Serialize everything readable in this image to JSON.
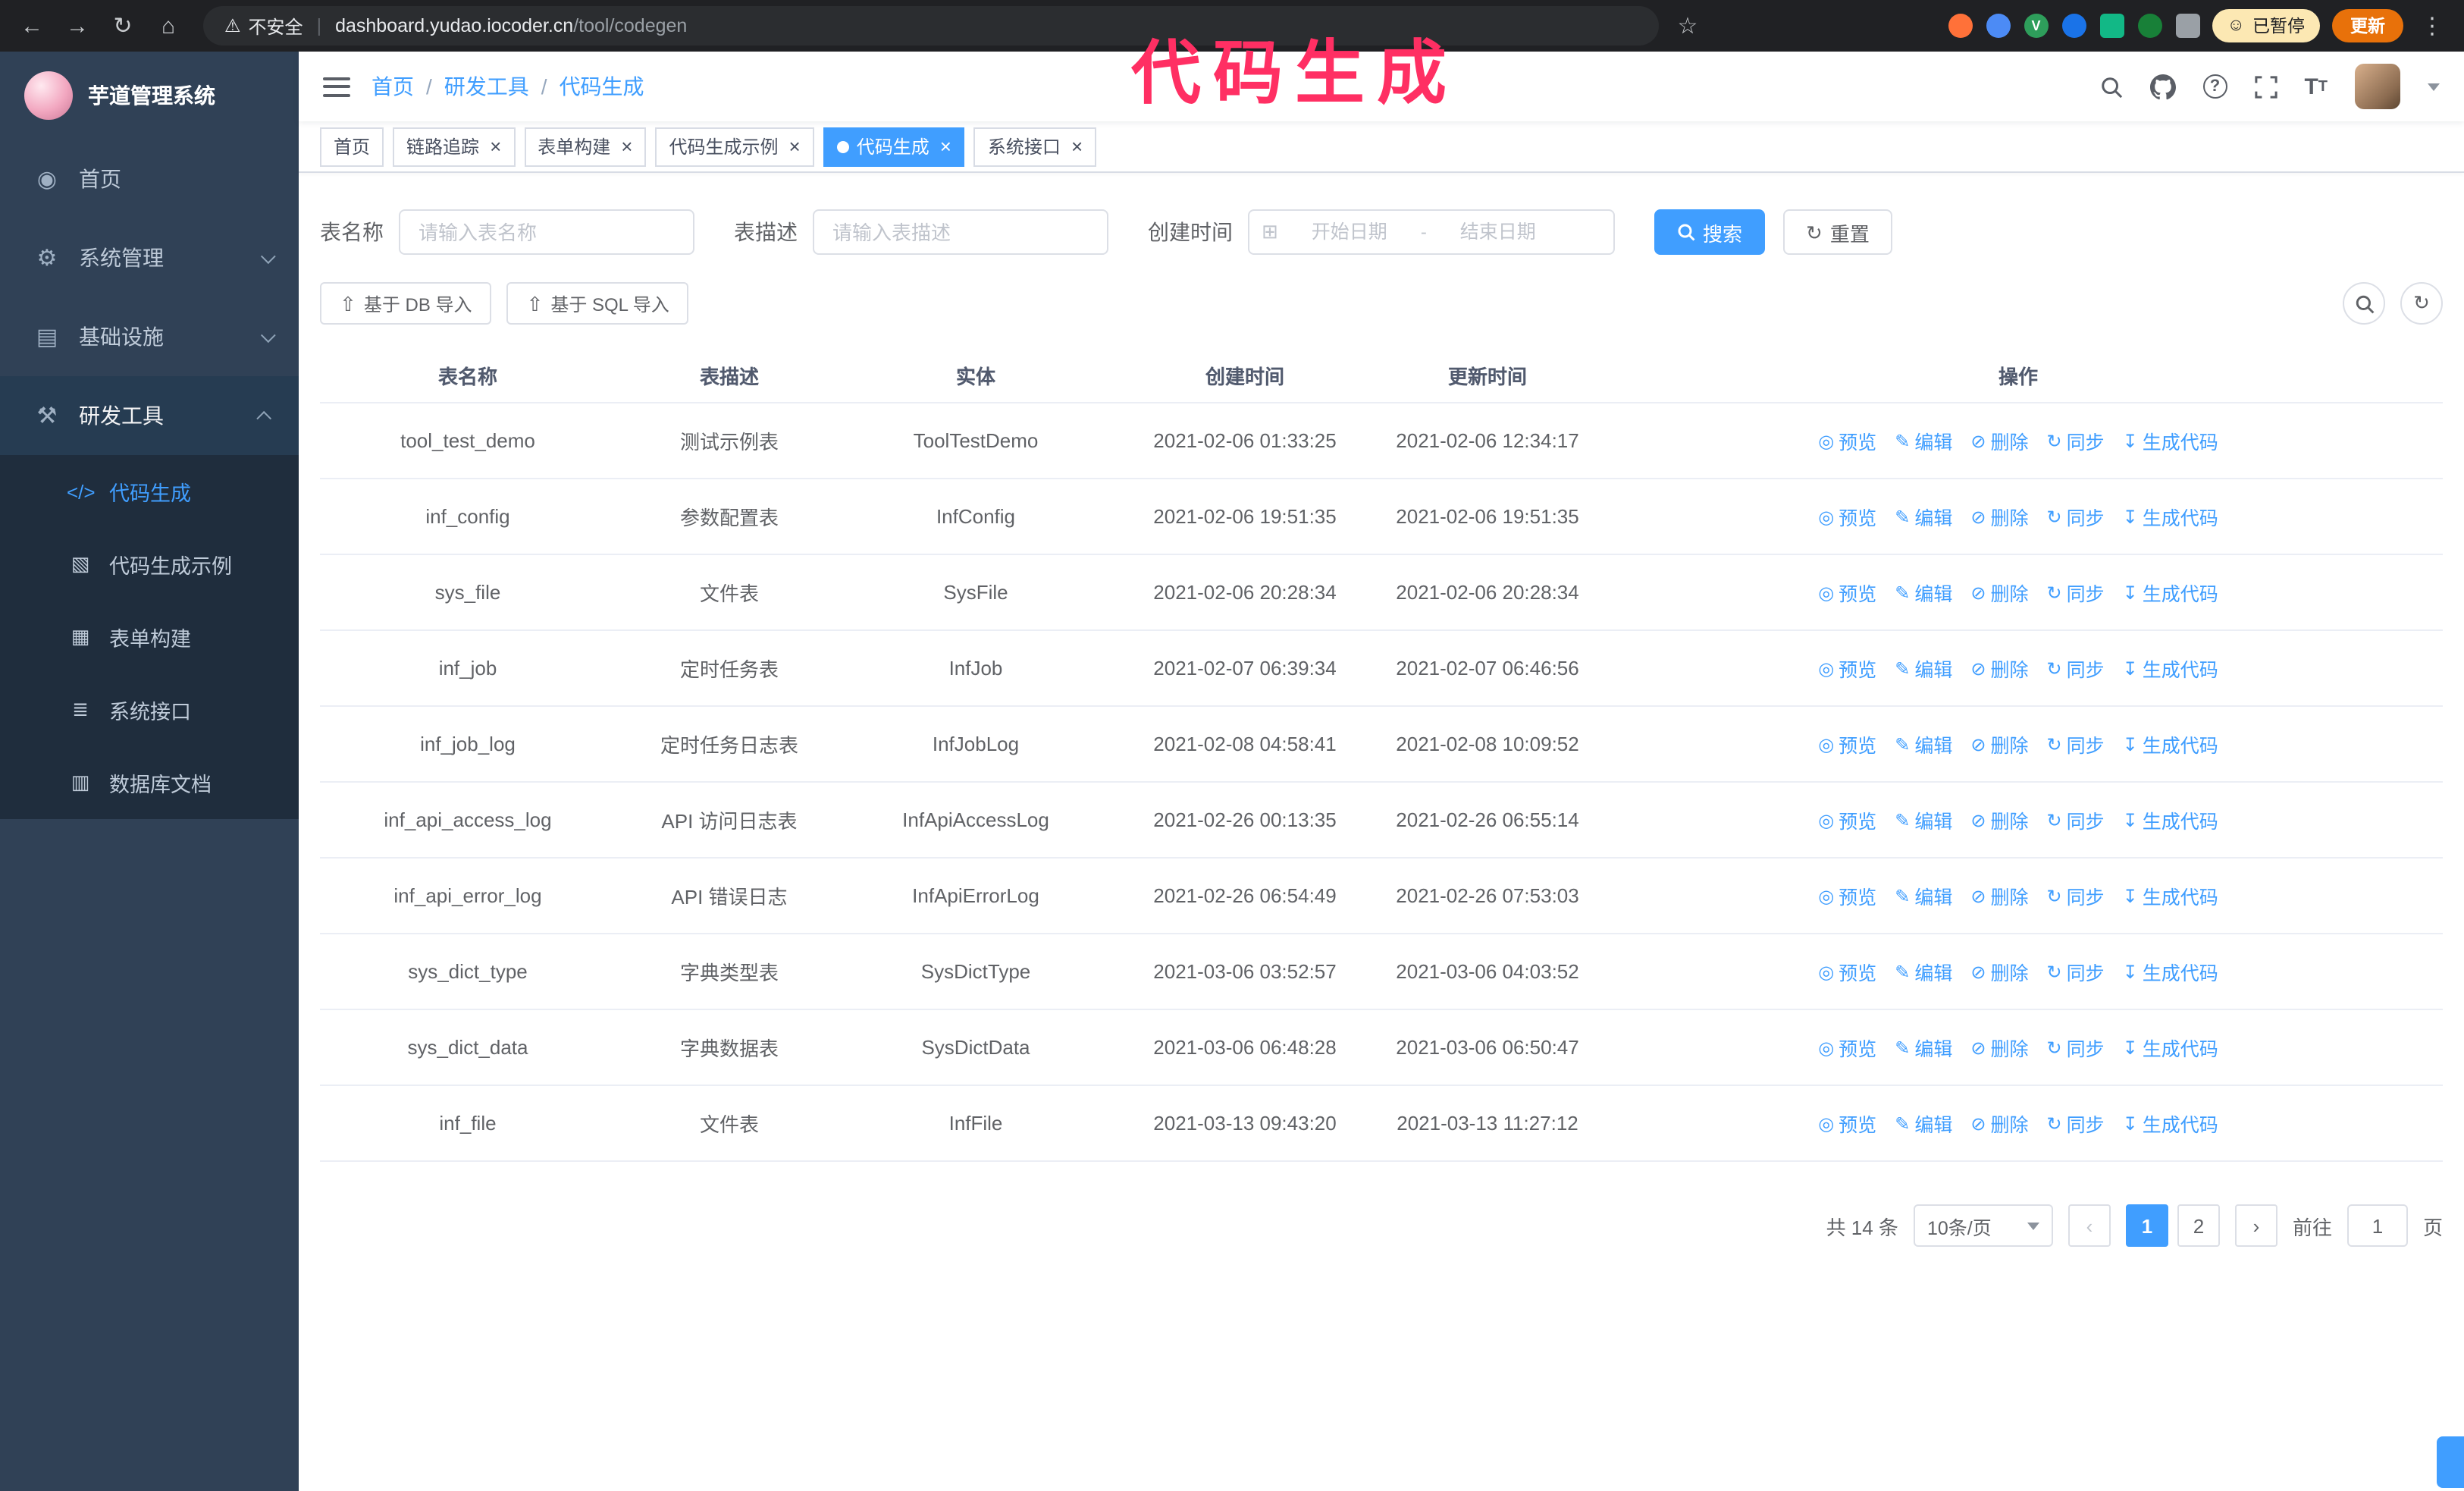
{
  "colors": {
    "accent": "#409eff",
    "annotation_pink": "#ff2f63",
    "sidebar_bg": "#304156",
    "submenu_bg": "#1f2d3d",
    "chrome_bg": "#202124",
    "update_button_orange": "#e8710a",
    "active_tab_bg": "#409eff"
  },
  "annotation": {
    "text": "代码生成"
  },
  "browser": {
    "security_label": "不安全",
    "url_host": "dashboard.yudao.iocoder.cn",
    "url_path": "/tool/codegen",
    "paused_label": "已暂停",
    "update_label": "更新",
    "extensions": [
      {
        "name": "orange-extension-icon",
        "color": "#ff7139"
      },
      {
        "name": "blue-drop-extension-icon",
        "color": "#4c8bf5"
      },
      {
        "name": "green-check-extension-icon",
        "color": "#2e9e5b",
        "glyph": "V"
      },
      {
        "name": "people-extension-icon",
        "color": "#1a73e8"
      },
      {
        "name": "green-square-extension-icon",
        "color": "#12b886",
        "square": true
      },
      {
        "name": "leaf-extension-icon",
        "color": "#188038"
      },
      {
        "name": "puzzle-extension-icon",
        "color": "#9aa0a6",
        "square": true
      }
    ]
  },
  "sidebar": {
    "logo_title": "芋道管理系统",
    "items": [
      {
        "key": "home",
        "label": "首页",
        "icon": "home"
      },
      {
        "key": "system",
        "label": "系统管理",
        "icon": "system",
        "chevron": "down"
      },
      {
        "key": "infra",
        "label": "基础设施",
        "icon": "infra",
        "chevron": "down"
      },
      {
        "key": "dev-tools",
        "label": "研发工具",
        "icon": "dev",
        "chevron": "up",
        "open": true
      }
    ],
    "subitems": [
      {
        "key": "codegen",
        "label": "代码生成",
        "icon": "codegen",
        "active": true
      },
      {
        "key": "codegen-example",
        "label": "代码生成示例",
        "icon": "example"
      },
      {
        "key": "form-builder",
        "label": "表单构建",
        "icon": "form"
      },
      {
        "key": "api",
        "label": "系统接口",
        "icon": "api"
      },
      {
        "key": "db-doc",
        "label": "数据库文档",
        "icon": "dbdoc"
      }
    ]
  },
  "header": {
    "breadcrumb": [
      "首页",
      "研发工具",
      "代码生成"
    ]
  },
  "tabs": [
    {
      "key": "home",
      "label": "首页",
      "closable": false,
      "active": false
    },
    {
      "key": "tracer",
      "label": "链路追踪",
      "closable": true,
      "active": false
    },
    {
      "key": "form-builder",
      "label": "表单构建",
      "closable": true,
      "active": false
    },
    {
      "key": "codegen-example",
      "label": "代码生成示例",
      "closable": true,
      "active": false
    },
    {
      "key": "codegen",
      "label": "代码生成",
      "closable": true,
      "active": true
    },
    {
      "key": "api",
      "label": "系统接口",
      "closable": true,
      "active": false
    }
  ],
  "filters": {
    "table_name_label": "表名称",
    "table_name_placeholder": "请输入表名称",
    "table_desc_label": "表描述",
    "table_desc_placeholder": "请输入表描述",
    "create_time_label": "创建时间",
    "date_start_placeholder": "开始日期",
    "date_separator": "-",
    "date_end_placeholder": "结束日期",
    "search_label": "搜索",
    "reset_label": "重置"
  },
  "toolbar": {
    "import_db_label": "基于 DB 导入",
    "import_sql_label": "基于 SQL 导入"
  },
  "table": {
    "columns": [
      "表名称",
      "表描述",
      "实体",
      "创建时间",
      "更新时间",
      "操作"
    ],
    "actions": [
      {
        "key": "preview",
        "label": "预览"
      },
      {
        "key": "edit",
        "label": "编辑"
      },
      {
        "key": "delete",
        "label": "删除"
      },
      {
        "key": "sync",
        "label": "同步"
      },
      {
        "key": "generate",
        "label": "生成代码"
      }
    ],
    "rows": [
      {
        "name": "tool_test_demo",
        "desc": "测试示例表",
        "entity": "ToolTestDemo",
        "created": "2021-02-06 01:33:25",
        "updated": "2021-02-06 12:34:17"
      },
      {
        "name": "inf_config",
        "desc": "参数配置表",
        "entity": "InfConfig",
        "created": "2021-02-06 19:51:35",
        "updated": "2021-02-06 19:51:35"
      },
      {
        "name": "sys_file",
        "desc": "文件表",
        "entity": "SysFile",
        "created": "2021-02-06 20:28:34",
        "updated": "2021-02-06 20:28:34"
      },
      {
        "name": "inf_job",
        "desc": "定时任务表",
        "entity": "InfJob",
        "created": "2021-02-07 06:39:34",
        "updated": "2021-02-07 06:46:56"
      },
      {
        "name": "inf_job_log",
        "desc": "定时任务日志表",
        "entity": "InfJobLog",
        "created": "2021-02-08 04:58:41",
        "updated": "2021-02-08 10:09:52"
      },
      {
        "name": "inf_api_access_log",
        "desc": "API 访问日志表",
        "entity": "InfApiAccessLog",
        "created": "2021-02-26 00:13:35",
        "updated": "2021-02-26 06:55:14"
      },
      {
        "name": "inf_api_error_log",
        "desc": "API 错误日志",
        "entity": "InfApiErrorLog",
        "created": "2021-02-26 06:54:49",
        "updated": "2021-02-26 07:53:03"
      },
      {
        "name": "sys_dict_type",
        "desc": "字典类型表",
        "entity": "SysDictType",
        "created": "2021-03-06 03:52:57",
        "updated": "2021-03-06 04:03:52"
      },
      {
        "name": "sys_dict_data",
        "desc": "字典数据表",
        "entity": "SysDictData",
        "created": "2021-03-06 06:48:28",
        "updated": "2021-03-06 06:50:47"
      },
      {
        "name": "inf_file",
        "desc": "文件表",
        "entity": "InfFile",
        "created": "2021-03-13 09:43:20",
        "updated": "2021-03-13 11:27:12"
      }
    ]
  },
  "pagination": {
    "total": "共 14 条",
    "page_size": "10条/页",
    "pages": [
      "1",
      "2"
    ],
    "active_page": "1",
    "goto_label": "前往",
    "goto_value": "1",
    "goto_unit": "页"
  },
  "icons": {
    "home": "◉",
    "system": "⚙",
    "infra": "▤",
    "dev": "⚒",
    "codegen": "</>",
    "example": "▧",
    "form": "▦",
    "api": "≣",
    "dbdoc": "▥",
    "upload": "⇧",
    "calendar": "⊞",
    "refresh": "↻",
    "preview": "◎",
    "edit": "✎",
    "delete": "⊘",
    "sync": "↻",
    "generate": "↧"
  }
}
